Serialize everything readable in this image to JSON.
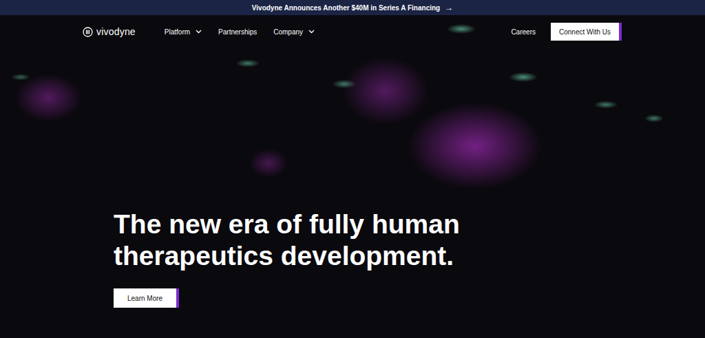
{
  "announcement": {
    "text": "Vivodyne Announces Another $40M in Series A Financing",
    "arrow": "→"
  },
  "nav": {
    "logo": "vivodyne",
    "items": [
      {
        "label": "Platform",
        "dropdown": true
      },
      {
        "label": "Partnerships",
        "dropdown": false
      },
      {
        "label": "Company",
        "dropdown": true
      }
    ],
    "careers": "Careers",
    "cta": "Connect With Us"
  },
  "hero": {
    "headline": [
      "The new era of fully human",
      "therapeutics development."
    ],
    "button": "Learn More"
  }
}
